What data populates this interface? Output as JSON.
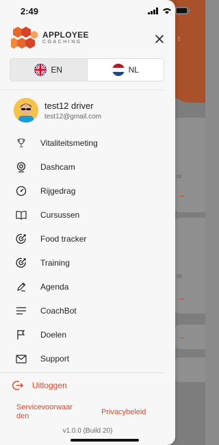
{
  "status_bar": {
    "time": "2:49"
  },
  "brand": {
    "name": "APPLOYEE",
    "sub": "COACHING"
  },
  "background": {
    "skip_hint": "t"
  },
  "language": {
    "options": [
      {
        "code": "EN",
        "flag": "uk-flag-icon"
      },
      {
        "code": "NL",
        "flag": "nl-flag-icon"
      }
    ],
    "selected": "NL"
  },
  "user": {
    "name": "test12 driver",
    "email": "test12@gmail.com"
  },
  "menu": {
    "items": [
      {
        "label": "Vitaliteitsmeting",
        "icon": "trophy-icon"
      },
      {
        "label": "Dashcam",
        "icon": "camera-icon"
      },
      {
        "label": "Rijgedrag",
        "icon": "speedometer-icon"
      },
      {
        "label": "Cursussen",
        "icon": "book-icon"
      },
      {
        "label": "Food tracker",
        "icon": "target-icon"
      },
      {
        "label": "Training",
        "icon": "target-icon"
      },
      {
        "label": "Agenda",
        "icon": "pencil-icon"
      },
      {
        "label": "CoachBot",
        "icon": "lines-icon"
      },
      {
        "label": "Doelen",
        "icon": "flag-icon"
      },
      {
        "label": "Support",
        "icon": "mail-icon"
      }
    ]
  },
  "logout": {
    "label": "Uitloggen"
  },
  "footer": {
    "terms_line1": "Servicevoorwaar",
    "terms_line2": "den",
    "privacy": "Privacybeleid",
    "version": "v1.0.0 (Build 20)"
  },
  "colors": {
    "accent": "#d4452a",
    "drawer_bg": "#f7f7f7",
    "brand_orange": "#e8672c"
  }
}
